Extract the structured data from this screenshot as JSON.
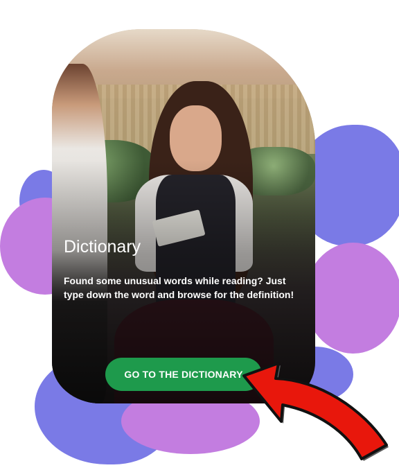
{
  "card": {
    "title": "Dictionary",
    "description": "Found some unusual words while reading? Just type down the word and browse for the definition!",
    "cta_label": "GO TO THE DICTIONARY"
  },
  "colors": {
    "cta_background": "#1e9a4c",
    "blob_blue": "#7a7ae6",
    "blob_purple": "#c37de0",
    "arrow_red": "#e8170c"
  },
  "icons": {
    "pointer": "red-arrow-icon"
  }
}
